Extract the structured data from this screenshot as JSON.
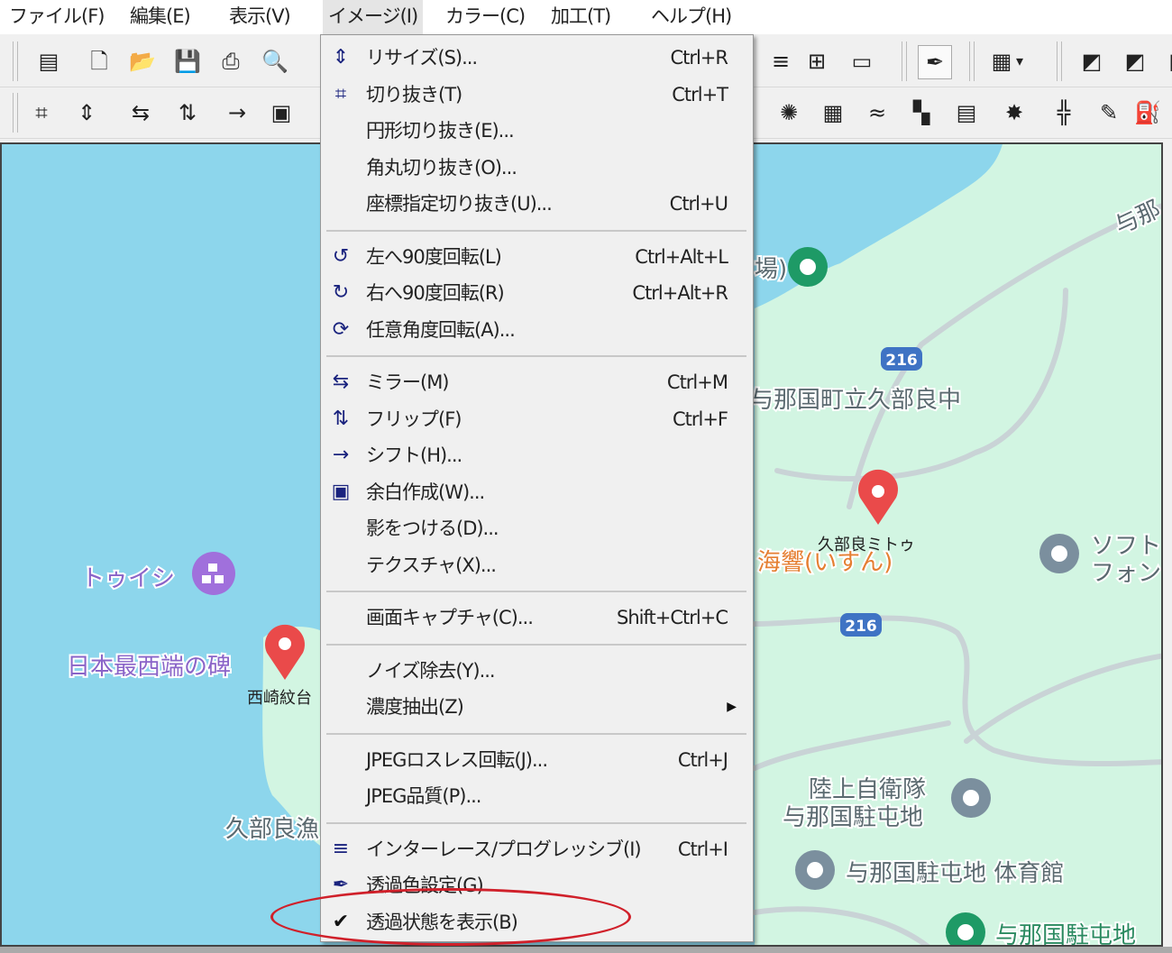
{
  "menubar": [
    {
      "label": "ファイル(F)"
    },
    {
      "label": "編集(E)"
    },
    {
      "label": "表示(V)"
    },
    {
      "label": "イメージ(I)",
      "open": true
    },
    {
      "label": "カラー(C)"
    },
    {
      "label": "加工(T)"
    },
    {
      "label": "ヘルプ(H)"
    }
  ],
  "toolbar_row1_icons": [
    "window-icon",
    "new-file-icon",
    "open-folder-icon",
    "save-icon",
    "print-icon",
    "print-preview-icon",
    "interlace-icon",
    "tile-view-icon",
    "filmstrip-icon",
    "eyedropper-icon",
    "color-grid-icon",
    "chevron-down-icon",
    "gradient-gray-icon",
    "gradient-gold-icon",
    "gradient-dark-icon"
  ],
  "toolbar_row2_icons": [
    "crop-icon",
    "resize-icon",
    "mirror-icon",
    "flip-icon",
    "shift-icon",
    "margin-icon",
    "blur-dots-icon",
    "brick-pattern-icon",
    "wave-icon",
    "mosaic-icon",
    "brick-wall-icon",
    "diffuse-icon",
    "tile-split-icon",
    "pen-icon",
    "paint-bucket-icon"
  ],
  "image_menu": {
    "items": [
      {
        "icon": "resize-icon",
        "label": "リサイズ(S)...",
        "shortcut": "Ctrl+R"
      },
      {
        "icon": "crop-icon",
        "label": "切り抜き(T)",
        "shortcut": "Ctrl+T"
      },
      {
        "label": "円形切り抜き(E)..."
      },
      {
        "label": "角丸切り抜き(O)..."
      },
      {
        "label": "座標指定切り抜き(U)...",
        "shortcut": "Ctrl+U"
      },
      {
        "separator": true
      },
      {
        "icon": "rotate-left-90-icon",
        "label": "左へ90度回転(L)",
        "shortcut": "Ctrl+Alt+L"
      },
      {
        "icon": "rotate-right-90-icon",
        "label": "右へ90度回転(R)",
        "shortcut": "Ctrl+Alt+R"
      },
      {
        "icon": "rotate-any-icon",
        "label": "任意角度回転(A)..."
      },
      {
        "separator": true
      },
      {
        "icon": "mirror-icon",
        "label": "ミラー(M)",
        "shortcut": "Ctrl+M"
      },
      {
        "icon": "flip-icon",
        "label": "フリップ(F)",
        "shortcut": "Ctrl+F"
      },
      {
        "icon": "shift-icon",
        "label": "シフト(H)..."
      },
      {
        "icon": "margin-icon",
        "label": "余白作成(W)..."
      },
      {
        "label": "影をつける(D)..."
      },
      {
        "label": "テクスチャ(X)..."
      },
      {
        "separator": true
      },
      {
        "label": "画面キャプチャ(C)...",
        "shortcut": "Shift+Ctrl+C"
      },
      {
        "separator": true
      },
      {
        "label": "ノイズ除去(Y)..."
      },
      {
        "label": "濃度抽出(Z)",
        "submenu": true
      },
      {
        "separator": true
      },
      {
        "label": "JPEGロスレス回転(J)...",
        "shortcut": "Ctrl+J"
      },
      {
        "label": "JPEG品質(P)..."
      },
      {
        "separator": true
      },
      {
        "icon": "interlace-icon",
        "label": "インターレース/プログレッシブ(I)",
        "shortcut": "Ctrl+I"
      },
      {
        "icon": "eyedropper-icon",
        "label": "透過色設定(G)"
      },
      {
        "icon": "checkmark-icon",
        "label": "透過状態を表示(B)",
        "checked": true,
        "highlighted_annotation": true
      }
    ]
  },
  "map": {
    "colors": {
      "water": "#8dd6ec",
      "land": "#d2f5e2",
      "road": "#c9d3d6",
      "route_badge": "#3f73c4",
      "pin_red": "#ea4a4a",
      "pin_green": "#1e9a66",
      "pin_gray": "#7b8f9e",
      "pin_purple": "#a070dc"
    },
    "labels": {
      "touishi": "トゥイシ",
      "monument": "日本最西端の碑",
      "monument_sub": "西崎紋台",
      "kubura_left": "久部良漁",
      "school": "与那国町立久部良中",
      "yonaguni_top": "与那",
      "partial_top": "場)",
      "lake_label": "久部良ミトゥ",
      "restaurant": "海響(いすん)",
      "softbank_1": "ソフト",
      "softbank_2": "フォン",
      "gsdf_1": "陸上自衛隊",
      "gsdf_2": "与那国駐屯地",
      "gym": "与那国駐屯地 体育館",
      "camp_bottom": "与那国駐屯地"
    },
    "route_numbers": [
      "216",
      "216"
    ]
  },
  "annotation": {
    "color": "#d0202a"
  }
}
